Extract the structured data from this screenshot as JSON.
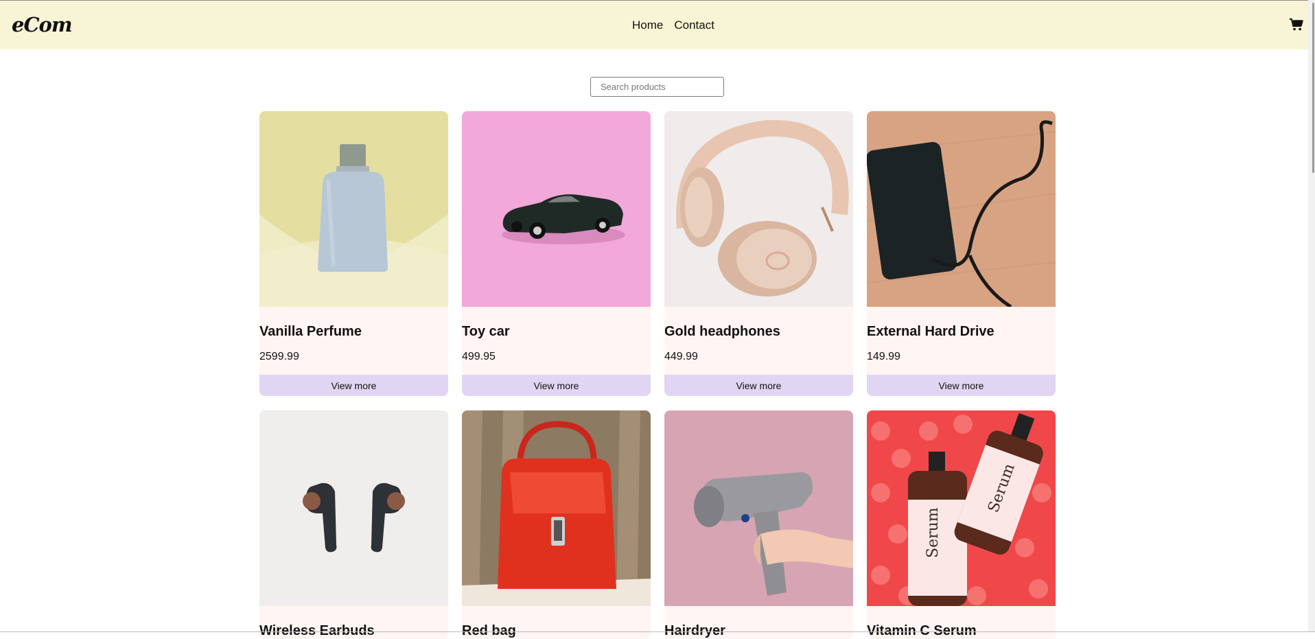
{
  "header": {
    "logo": "eCom",
    "nav": [
      {
        "label": "Home"
      },
      {
        "label": "Contact"
      }
    ],
    "cart_icon": "shopping-cart-icon"
  },
  "search": {
    "placeholder": "Search products",
    "value": ""
  },
  "products": [
    {
      "name": "Vanilla Perfume",
      "price": "2599.99",
      "button": "View more",
      "image": "perfume-bottle"
    },
    {
      "name": "Toy car",
      "price": "499.95",
      "button": "View more",
      "image": "toy-car"
    },
    {
      "name": "Gold headphones",
      "price": "449.99",
      "button": "View more",
      "image": "headphones"
    },
    {
      "name": "External Hard Drive",
      "price": "149.99",
      "button": "View more",
      "image": "hard-drive"
    },
    {
      "name": "Wireless Earbuds",
      "image": "earbuds"
    },
    {
      "name": "Red bag",
      "image": "red-handbag"
    },
    {
      "name": "Hairdryer",
      "image": "hairdryer"
    },
    {
      "name": "Vitamin C Serum",
      "image": "serum-bottles",
      "image_text": [
        "Serum",
        "Serum"
      ]
    }
  ],
  "colors": {
    "header_bg": "#f8f5d6",
    "card_bg": "#fff5f3",
    "button_bg": "#e0d5f3"
  }
}
